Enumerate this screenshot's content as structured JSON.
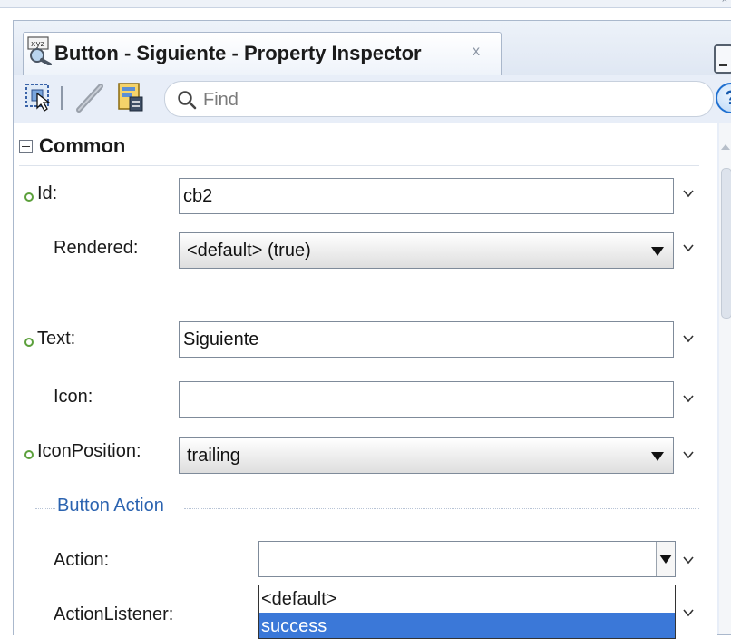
{
  "tab": {
    "title": "Button - Siguiente - Property Inspector",
    "close_label": "x"
  },
  "toolbar": {
    "search_placeholder": "Find",
    "help_label": "?"
  },
  "section": {
    "title": "Common"
  },
  "properties": {
    "id": {
      "label": "Id:",
      "value": "cb2"
    },
    "rendered": {
      "label": "Rendered:",
      "value": "<default> (true)"
    },
    "text": {
      "label": "Text:",
      "value": "Siguiente"
    },
    "icon": {
      "label": "Icon:",
      "value": ""
    },
    "icon_position": {
      "label": "IconPosition:",
      "value": "trailing"
    }
  },
  "group": {
    "title": "Button Action"
  },
  "action": {
    "label": "Action:",
    "value": "",
    "options": [
      "<default>",
      "success"
    ],
    "highlighted_option": "success"
  },
  "action_listener": {
    "label": "ActionListener:"
  },
  "colors": {
    "selection": "#3b78d8",
    "group_title": "#2b63b0",
    "set_indicator": "#5ca03c"
  },
  "icons": {
    "tab": "property-inspector-icon",
    "select_tool": "select-tool-icon",
    "edit": "pencil-icon",
    "binding": "binding-icon",
    "search": "search-icon",
    "help": "help-icon"
  }
}
